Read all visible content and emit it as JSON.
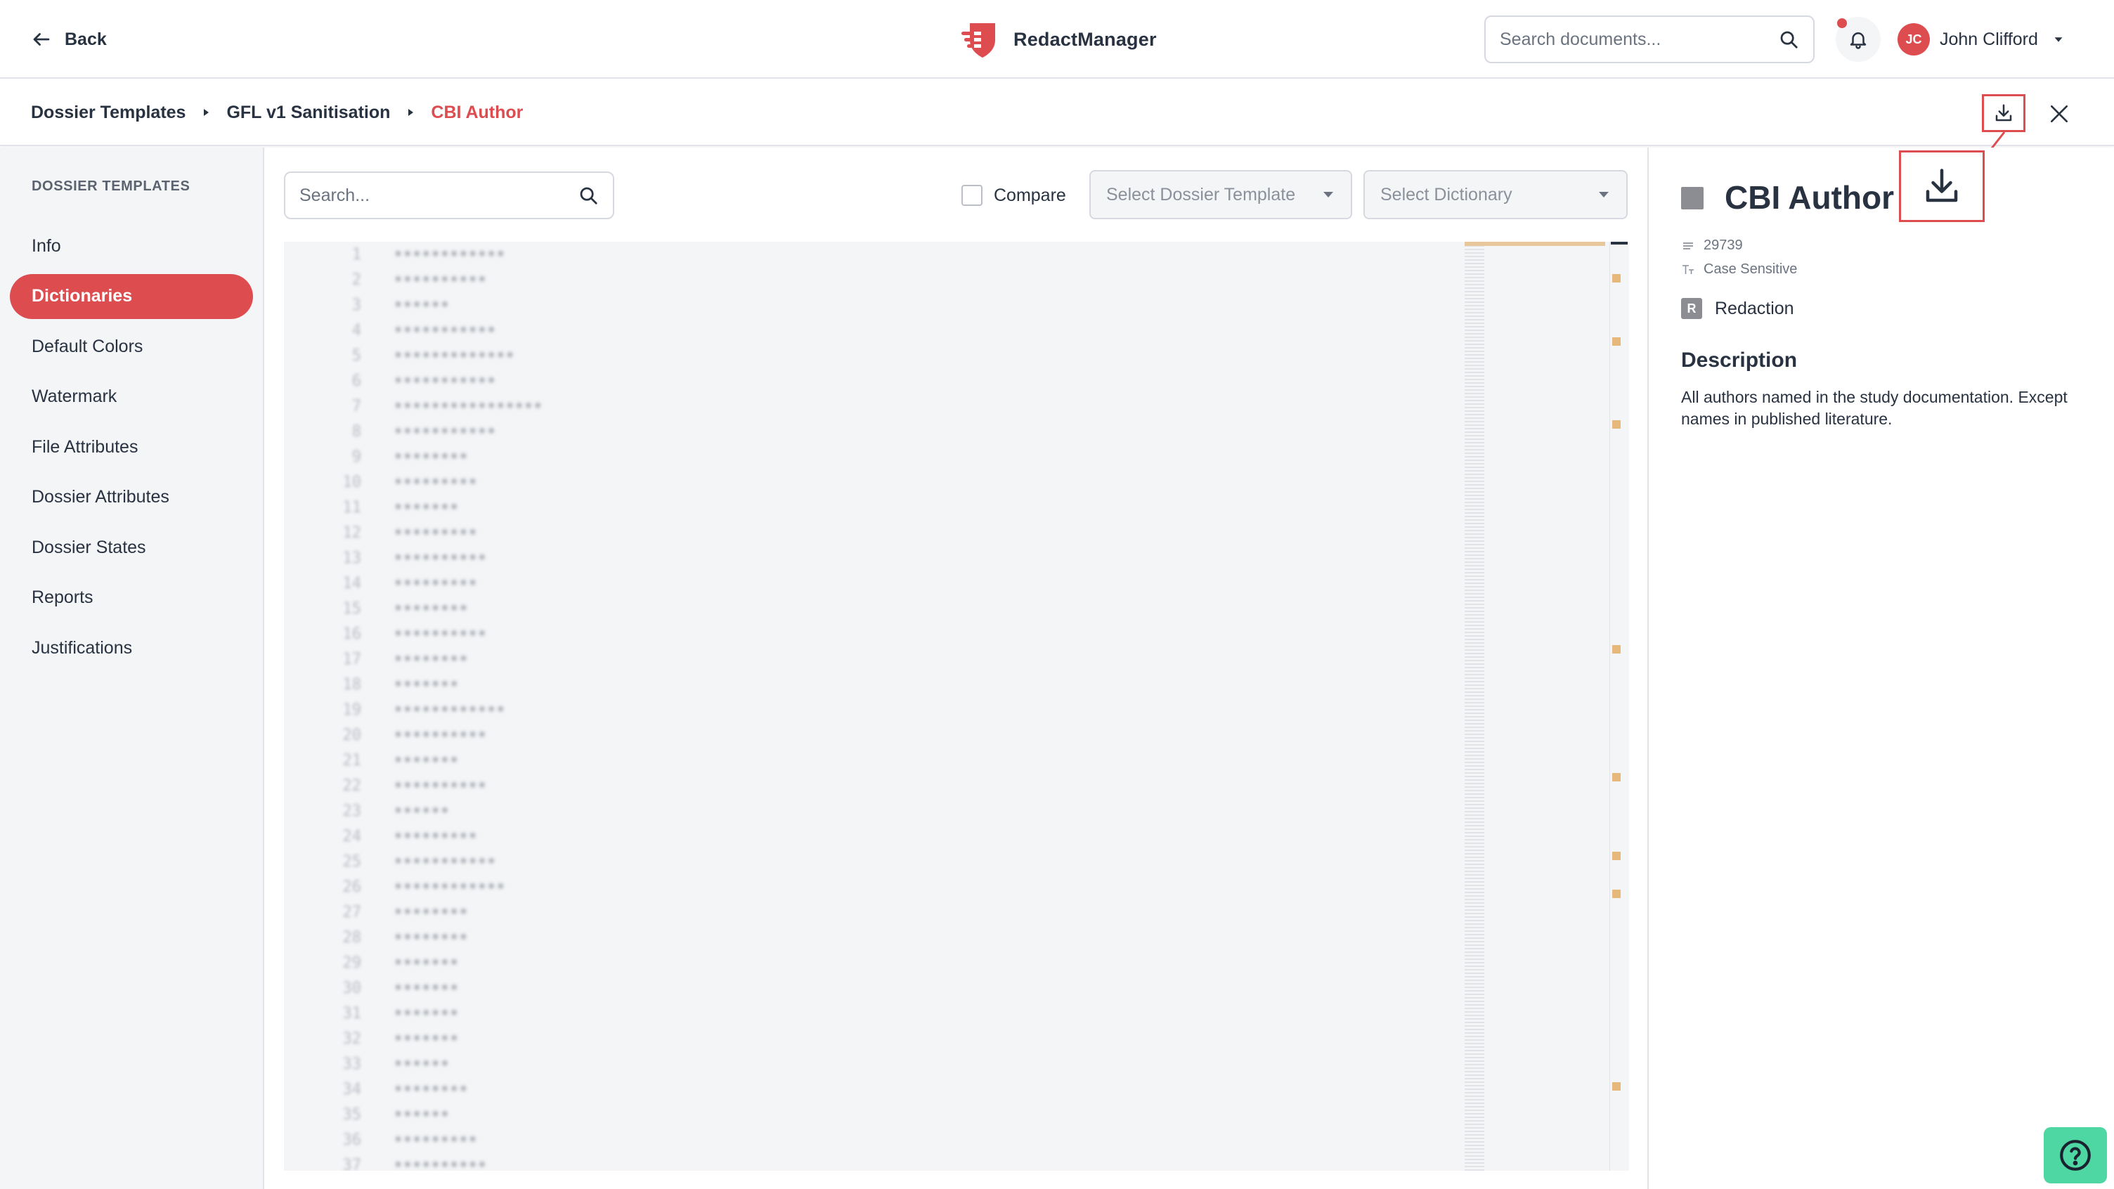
{
  "topbar": {
    "back_label": "Back",
    "brand": "RedactManager",
    "search_placeholder": "Search documents...",
    "user": {
      "initials": "JC",
      "name": "John Clifford"
    }
  },
  "breadcrumb": {
    "items": [
      {
        "label": "Dossier Templates"
      },
      {
        "label": "GFL v1 Sanitisation"
      },
      {
        "label": "CBI Author",
        "active": true
      }
    ]
  },
  "sidebar": {
    "heading": "DOSSIER TEMPLATES",
    "items": [
      {
        "label": "Info"
      },
      {
        "label": "Dictionaries",
        "active": true
      },
      {
        "label": "Default Colors"
      },
      {
        "label": "Watermark"
      },
      {
        "label": "File Attributes"
      },
      {
        "label": "Dossier Attributes"
      },
      {
        "label": "Dossier States"
      },
      {
        "label": "Reports"
      },
      {
        "label": "Justifications"
      }
    ]
  },
  "toolbar": {
    "search_placeholder": "Search...",
    "compare_label": "Compare",
    "template_select_placeholder": "Select Dossier Template",
    "dictionary_select_placeholder": "Select Dictionary"
  },
  "editor": {
    "line_numbers": [
      "1",
      "2",
      "3",
      "4",
      "5",
      "6",
      "7",
      "8",
      "9",
      "10",
      "11",
      "12",
      "13",
      "14",
      "15",
      "16",
      "17",
      "18",
      "19",
      "20",
      "21",
      "22",
      "23",
      "24",
      "25",
      "26",
      "27",
      "28",
      "29",
      "30",
      "31",
      "32",
      "33",
      "34",
      "35",
      "36",
      "37"
    ]
  },
  "panel": {
    "title": "CBI Author",
    "entry_count": "29739",
    "case_label": "Case Sensitive",
    "type_badge": "R",
    "type_label": "Redaction",
    "description_heading": "Description",
    "description": "All authors named in the study documentation. Except names in published literature."
  },
  "colors": {
    "accent": "#dd4d50",
    "sidebar_bg": "#f4f5f7",
    "help": "#4ed7a2"
  },
  "icons": {
    "back": "arrow-left-icon",
    "search": "search-icon",
    "bell": "bell-icon",
    "download": "download-icon",
    "close": "close-icon",
    "help": "help-icon"
  }
}
